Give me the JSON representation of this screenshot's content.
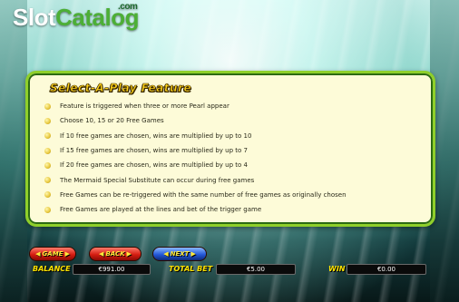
{
  "logo": {
    "prefix": "Slot",
    "name": "Catalog",
    "suffix": ".com"
  },
  "feature_panel": {
    "title": "Select-A-Play Feature",
    "rules": [
      "Feature is triggered when three or more Pearl appear",
      "Choose 10, 15 or 20 Free Games",
      "If 10 free games are chosen, wins are multiplied by up to 10",
      "If 15 free games are chosen, wins are multiplied by up to 7",
      "If 20 free games are chosen, wins are multiplied by up to 4",
      "The Mermaid Special Substitute can occur during free games",
      "Free Games can be re-triggered with the same number of free games as originally chosen",
      "Free Games are played at the lines and bet of the trigger game"
    ]
  },
  "nav_buttons": {
    "game": "GAME",
    "back": "BACK",
    "next": "NEXT"
  },
  "hud": {
    "balance_label": "BALANCE",
    "balance_value": "€991.00",
    "total_bet_label": "TOTAL BET",
    "total_bet_value": "€5.00",
    "win_label": "WIN",
    "win_value": "€0.00"
  },
  "colors": {
    "panel_border": "#8fcf2a",
    "panel_bg": "#fdfbd8",
    "title_yellow": "#ffd21a",
    "button_red": "#d51d12",
    "button_blue": "#2458d8",
    "hud_label": "#ffe400"
  },
  "icons": {
    "bullet": "pearl-bullet-icon",
    "arrow_left": "left-arrow-icon",
    "arrow_right": "right-arrow-icon"
  }
}
